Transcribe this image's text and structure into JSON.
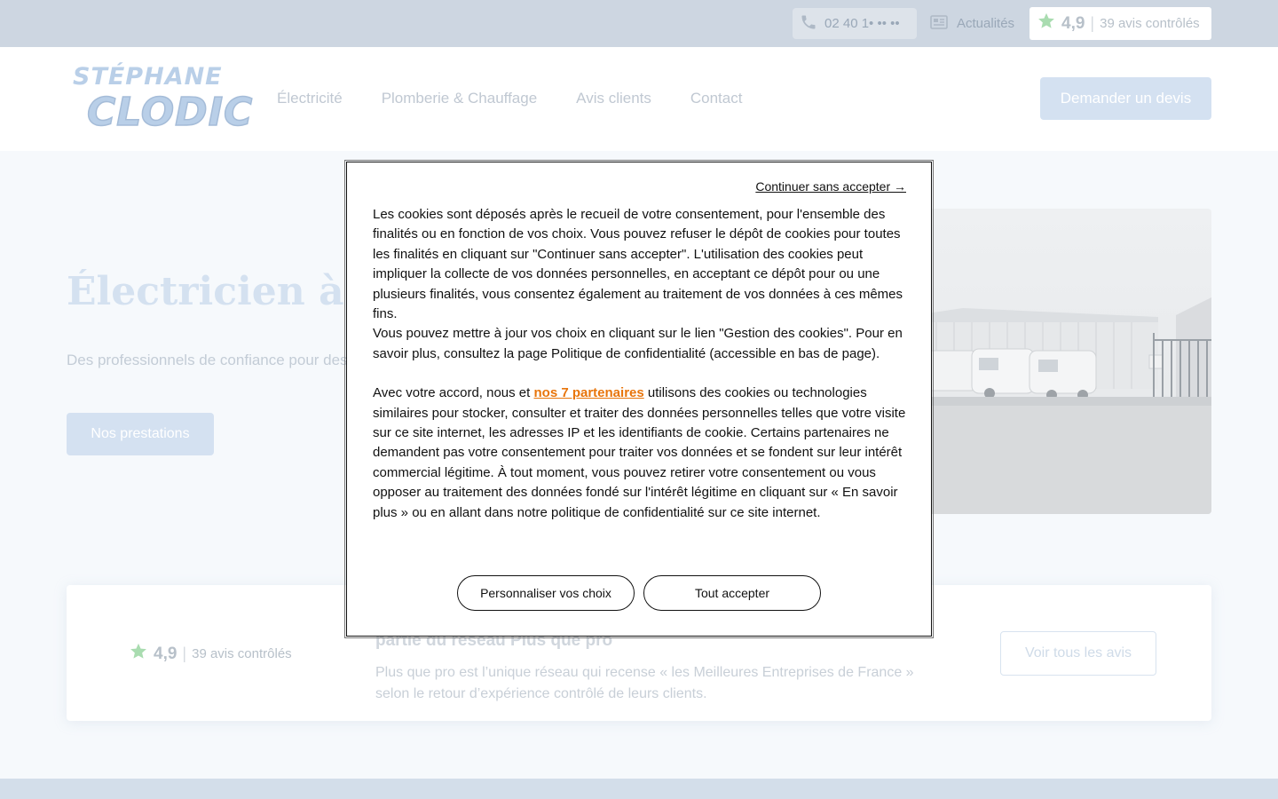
{
  "topbar": {
    "phone": "02 40 1• •• ••",
    "news_label": "Actualités",
    "rating_score": "4,9",
    "rating_count": "39 avis contrôlés"
  },
  "header": {
    "logo_line1": "STÉPHANE",
    "logo_line2": "CLODIC",
    "nav": [
      "Électricité",
      "Plomberie & Chauffage",
      "Avis clients",
      "Contact"
    ],
    "devis_label": "Demander un devis"
  },
  "hero": {
    "title": "Électricien à Miss",
    "subtitle": "Des professionnels de confiance pour des",
    "button_label": "Nos prestations"
  },
  "reviews": {
    "rating_score": "4,9",
    "rating_count": "39 avis contrôlés",
    "title": "partie du réseau Plus que pro",
    "text": "Plus que pro est l’unique réseau qui recense « les Meilleures Entreprises de France » selon le retour d’expérience contrôlé de leurs clients.",
    "button_label": "Voir tous les avis"
  },
  "cookie": {
    "skip_label": "Continuer sans accepter →",
    "para1": "Les cookies sont déposés après le recueil de votre consentement, pour l'ensemble des finalités ou en fonction de vos choix. Vous pouvez refuser le dépôt de cookies pour toutes les finalités en cliquant sur \"Continuer sans accepter\". L'utilisation des cookies peut impliquer la collecte de vos données personnelles, en acceptant ce dépôt pour ou une plusieurs finalités, vous consentez également au traitement de vos données à ces mêmes fins.",
    "para2": "Vous pouvez mettre à jour vos choix en cliquant sur le lien \"Gestion des cookies\". Pour en savoir plus, consultez la page Politique de confidentialité (accessible en bas de page).",
    "para3_before": "Avec votre accord, nous et ",
    "partners_link": "nos 7 partenaires",
    "para3_after": " utilisons des cookies ou technologies similaires pour stocker, consulter et traiter des données personnelles telles que votre visite sur ce site internet, les adresses IP et les identifiants de cookie. Certains partenaires ne demandent pas votre consentement pour traiter vos données et se fondent sur leur intérêt commercial légitime. À tout moment, vous pouvez retirer votre consentement ou vous opposer au traitement des données fondé sur l'intérêt légitime en cliquant sur « En savoir plus » ou en allant dans notre politique de confidentialité sur ce site internet.",
    "customize_label": "Personnaliser vos choix",
    "accept_label": "Tout accepter"
  },
  "colors": {
    "accent_light": "#d4e1f1",
    "link_orange": "#e8750b",
    "star_green": "#4caf50"
  }
}
